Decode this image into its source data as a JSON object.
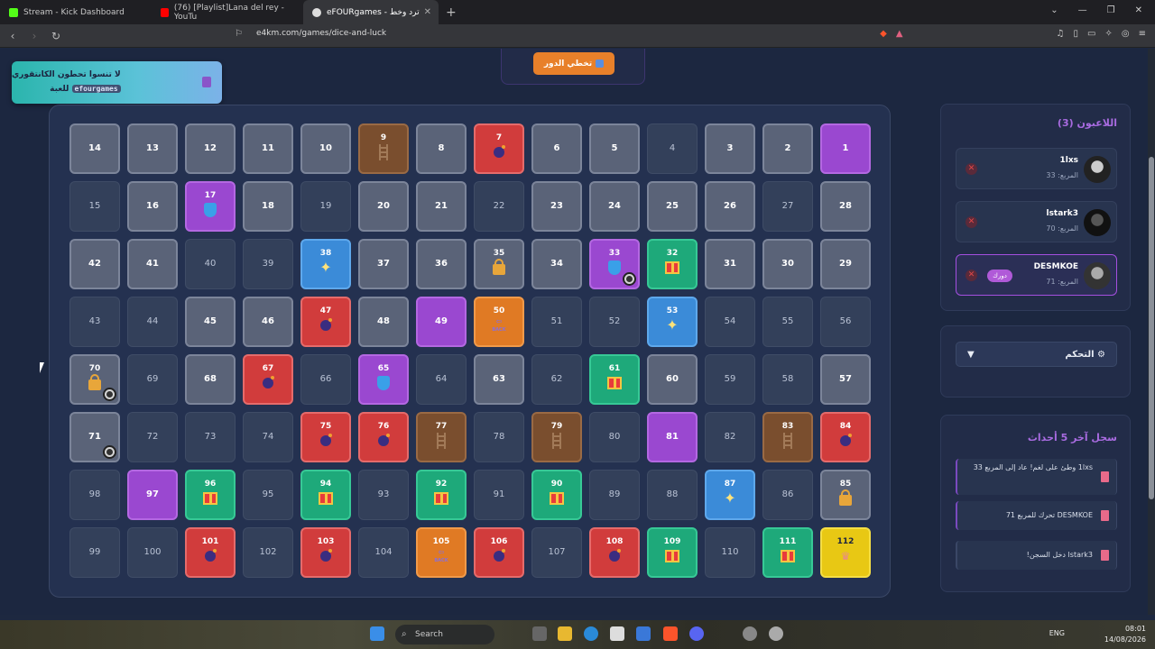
{
  "browser": {
    "tabs": [
      {
        "label": "Stream - Kick Dashboard",
        "color": "#53fc18"
      },
      {
        "label": "(76) [Playlist]Lana del rey - YouTu",
        "color": "#ff0000"
      },
      {
        "label": "eFOURgames - ترد وخط",
        "color": "#dddddd"
      }
    ],
    "url": "e4km.com/games/dice-and-luck"
  },
  "notice": {
    "line1": "لا تنسوا تحطون الكانتقوري",
    "code": "efourgames",
    "line2": "للعبة"
  },
  "skip_button": {
    "label": "تخطي الدور"
  },
  "board": {
    "cells": [
      {
        "n": "14",
        "t": "plain"
      },
      {
        "n": "13",
        "t": "plain"
      },
      {
        "n": "12",
        "t": "plain"
      },
      {
        "n": "11",
        "t": "plain"
      },
      {
        "n": "10",
        "t": "plain"
      },
      {
        "n": "9",
        "t": "ladder",
        "i": "ladder"
      },
      {
        "n": "8",
        "t": "plain"
      },
      {
        "n": "7",
        "t": "red",
        "i": "bomb"
      },
      {
        "n": "6",
        "t": "plain"
      },
      {
        "n": "5",
        "t": "plain"
      },
      {
        "n": "4",
        "t": "dark"
      },
      {
        "n": "3",
        "t": "plain"
      },
      {
        "n": "2",
        "t": "plain"
      },
      {
        "n": "1",
        "t": "purple"
      },
      {
        "n": "15",
        "t": "dark"
      },
      {
        "n": "16",
        "t": "plain"
      },
      {
        "n": "17",
        "t": "purple",
        "i": "shield"
      },
      {
        "n": "18",
        "t": "plain"
      },
      {
        "n": "19",
        "t": "dark"
      },
      {
        "n": "20",
        "t": "plain"
      },
      {
        "n": "21",
        "t": "plain"
      },
      {
        "n": "22",
        "t": "dark"
      },
      {
        "n": "23",
        "t": "plain"
      },
      {
        "n": "24",
        "t": "plain"
      },
      {
        "n": "25",
        "t": "plain"
      },
      {
        "n": "26",
        "t": "plain"
      },
      {
        "n": "27",
        "t": "dark"
      },
      {
        "n": "28",
        "t": "plain"
      },
      {
        "n": "42",
        "t": "plain"
      },
      {
        "n": "41",
        "t": "plain"
      },
      {
        "n": "40",
        "t": "dark"
      },
      {
        "n": "39",
        "t": "dark"
      },
      {
        "n": "38",
        "t": "blue",
        "i": "sparkle"
      },
      {
        "n": "37",
        "t": "plain"
      },
      {
        "n": "36",
        "t": "plain"
      },
      {
        "n": "35",
        "t": "lock",
        "i": "lock"
      },
      {
        "n": "34",
        "t": "plain"
      },
      {
        "n": "33",
        "t": "purple",
        "i": "shield",
        "token": true
      },
      {
        "n": "32",
        "t": "green",
        "i": "gift"
      },
      {
        "n": "31",
        "t": "plain"
      },
      {
        "n": "30",
        "t": "plain"
      },
      {
        "n": "29",
        "t": "plain"
      },
      {
        "n": "43",
        "t": "dark"
      },
      {
        "n": "44",
        "t": "dark"
      },
      {
        "n": "45",
        "t": "plain"
      },
      {
        "n": "46",
        "t": "plain"
      },
      {
        "n": "47",
        "t": "red",
        "i": "bomb"
      },
      {
        "n": "48",
        "t": "plain"
      },
      {
        "n": "49",
        "t": "purple"
      },
      {
        "n": "50",
        "t": "back",
        "i": "back"
      },
      {
        "n": "51",
        "t": "dark"
      },
      {
        "n": "52",
        "t": "dark"
      },
      {
        "n": "53",
        "t": "blue",
        "i": "sparkle"
      },
      {
        "n": "54",
        "t": "dark"
      },
      {
        "n": "55",
        "t": "dark"
      },
      {
        "n": "56",
        "t": "dark"
      },
      {
        "n": "70",
        "t": "lock",
        "i": "lock",
        "token": true
      },
      {
        "n": "69",
        "t": "dark"
      },
      {
        "n": "68",
        "t": "plain"
      },
      {
        "n": "67",
        "t": "red",
        "i": "bomb"
      },
      {
        "n": "66",
        "t": "dark"
      },
      {
        "n": "65",
        "t": "purple",
        "i": "shield"
      },
      {
        "n": "64",
        "t": "dark"
      },
      {
        "n": "63",
        "t": "plain"
      },
      {
        "n": "62",
        "t": "dark"
      },
      {
        "n": "61",
        "t": "green",
        "i": "gift"
      },
      {
        "n": "60",
        "t": "plain"
      },
      {
        "n": "59",
        "t": "dark"
      },
      {
        "n": "58",
        "t": "dark"
      },
      {
        "n": "57",
        "t": "plain"
      },
      {
        "n": "71",
        "t": "plain",
        "token": true
      },
      {
        "n": "72",
        "t": "dark"
      },
      {
        "n": "73",
        "t": "dark"
      },
      {
        "n": "74",
        "t": "dark"
      },
      {
        "n": "75",
        "t": "red",
        "i": "bomb"
      },
      {
        "n": "76",
        "t": "red",
        "i": "bomb"
      },
      {
        "n": "77",
        "t": "ladder",
        "i": "ladder"
      },
      {
        "n": "78",
        "t": "dark"
      },
      {
        "n": "79",
        "t": "ladder",
        "i": "ladder"
      },
      {
        "n": "80",
        "t": "dark"
      },
      {
        "n": "81",
        "t": "purple"
      },
      {
        "n": "82",
        "t": "dark"
      },
      {
        "n": "83",
        "t": "ladder",
        "i": "ladder"
      },
      {
        "n": "84",
        "t": "red",
        "i": "bomb"
      },
      {
        "n": "98",
        "t": "dark"
      },
      {
        "n": "97",
        "t": "purple"
      },
      {
        "n": "96",
        "t": "green",
        "i": "gift"
      },
      {
        "n": "95",
        "t": "dark"
      },
      {
        "n": "94",
        "t": "green",
        "i": "gift"
      },
      {
        "n": "93",
        "t": "dark"
      },
      {
        "n": "92",
        "t": "green",
        "i": "gift"
      },
      {
        "n": "91",
        "t": "dark"
      },
      {
        "n": "90",
        "t": "green",
        "i": "gift"
      },
      {
        "n": "89",
        "t": "dark"
      },
      {
        "n": "88",
        "t": "dark"
      },
      {
        "n": "87",
        "t": "blue",
        "i": "sparkle"
      },
      {
        "n": "86",
        "t": "dark"
      },
      {
        "n": "85",
        "t": "lock",
        "i": "lock"
      },
      {
        "n": "99",
        "t": "dark"
      },
      {
        "n": "100",
        "t": "dark"
      },
      {
        "n": "101",
        "t": "red",
        "i": "bomb"
      },
      {
        "n": "102",
        "t": "dark"
      },
      {
        "n": "103",
        "t": "red",
        "i": "bomb"
      },
      {
        "n": "104",
        "t": "dark"
      },
      {
        "n": "105",
        "t": "back",
        "i": "back"
      },
      {
        "n": "106",
        "t": "red",
        "i": "bomb"
      },
      {
        "n": "107",
        "t": "dark"
      },
      {
        "n": "108",
        "t": "red",
        "i": "bomb"
      },
      {
        "n": "109",
        "t": "green",
        "i": "gift"
      },
      {
        "n": "110",
        "t": "dark"
      },
      {
        "n": "111",
        "t": "green",
        "i": "gift"
      },
      {
        "n": "112",
        "t": "gold",
        "i": "crown"
      }
    ],
    "back_label": "BACK"
  },
  "players": {
    "title": "اللاعبون (3)",
    "list": [
      {
        "name": "1lxs",
        "score": "المربع: 33",
        "current": false
      },
      {
        "name": "lstark3",
        "score": "المربع: 70",
        "current": false
      },
      {
        "name": "DESMKOE",
        "score": "المربع: 71",
        "current": true,
        "badge": "دورك"
      }
    ]
  },
  "controls": {
    "label": "⚙ التحكم"
  },
  "log": {
    "title": "سجل آخر 5 أحداث",
    "entries": [
      "1lxs وطئ على لغم! عاد إلى المربع 33",
      "DESMKOE تحرك للمربع 71",
      "lstark3 دخل السجن!"
    ]
  },
  "taskbar": {
    "search": "Search",
    "lang": "ENG",
    "time": "08:01",
    "date": "14/08/2026"
  }
}
